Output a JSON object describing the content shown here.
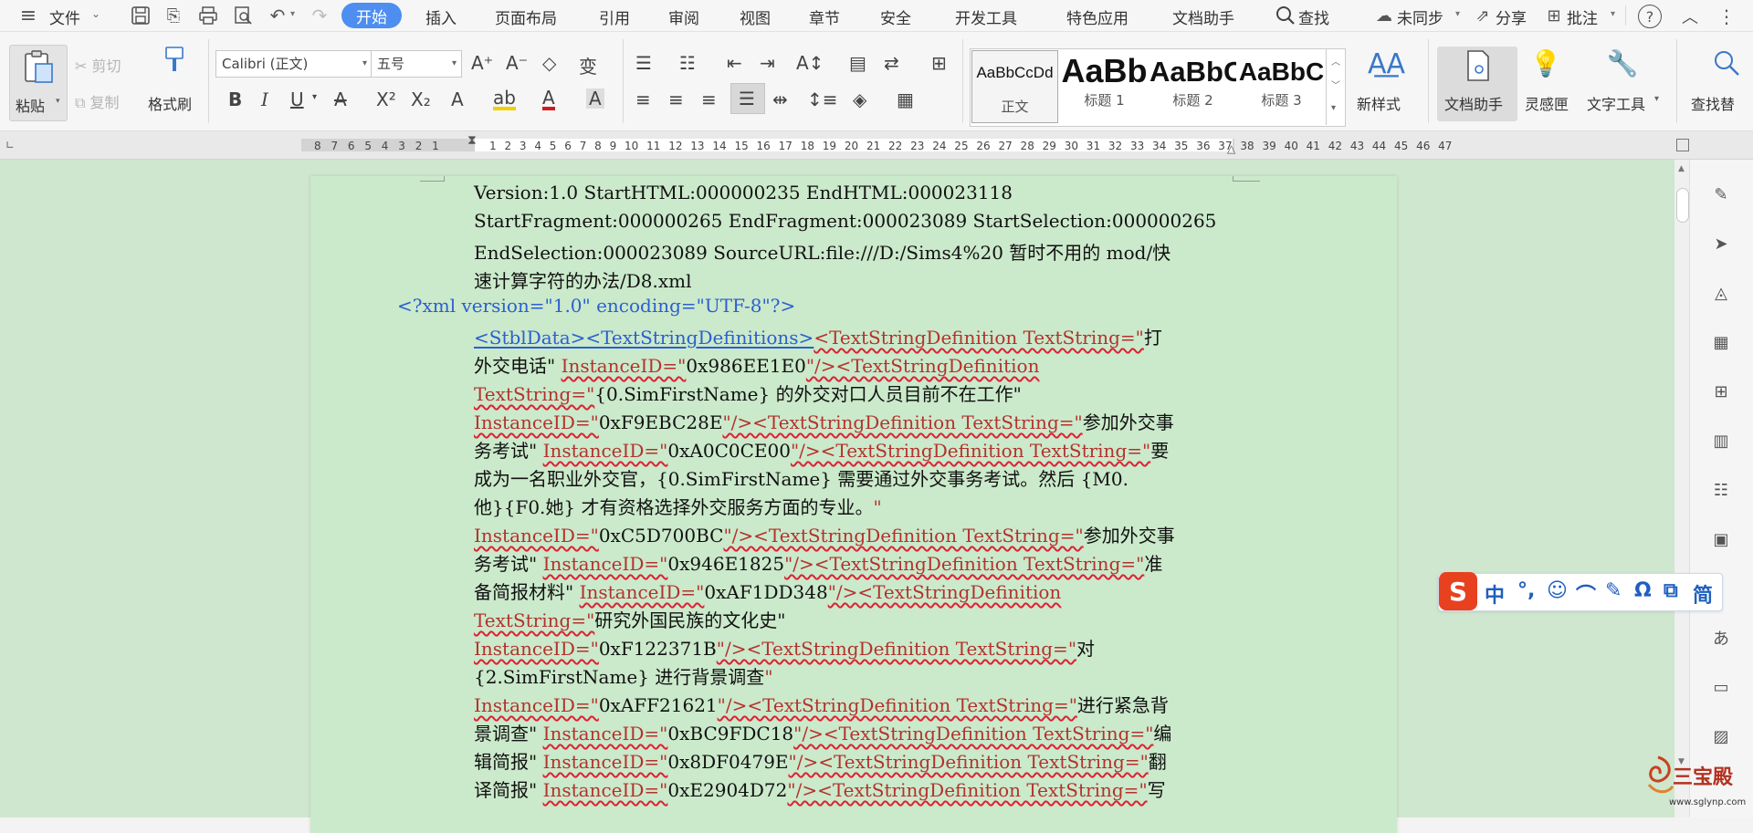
{
  "menubar": {
    "file_label": "文件",
    "tabs": [
      {
        "label": "开始",
        "active": true
      },
      {
        "label": "插入"
      },
      {
        "label": "页面布局"
      },
      {
        "label": "引用"
      },
      {
        "label": "审阅"
      },
      {
        "label": "视图"
      },
      {
        "label": "章节"
      },
      {
        "label": "安全"
      },
      {
        "label": "开发工具"
      },
      {
        "label": "特色应用"
      },
      {
        "label": "文档助手"
      }
    ],
    "search_label": "查找",
    "sync_label": "未同步",
    "share_label": "分享",
    "comment_label": "批注"
  },
  "ribbon": {
    "paste_label": "粘贴",
    "cut_label": "剪切",
    "copy_label": "复制",
    "format_painter_label": "格式刷",
    "font_name": "Calibri (正文)",
    "font_size": "五号",
    "styles": [
      {
        "sample": "AaBbCcDd",
        "caption": "正文"
      },
      {
        "sample": "AaBb",
        "caption": "标题 1"
      },
      {
        "sample": "AaBbC",
        "caption": "标题 2"
      },
      {
        "sample": "AaBbC",
        "caption": "标题 3"
      }
    ],
    "new_style_label": "新样式",
    "doc_assistant_label": "文档助手",
    "inspiration_label": "灵感匣",
    "text_tools_label": "文字工具",
    "find_replace_label": "查找替"
  },
  "ruler": {
    "left_numbers": "8 7 6 5 4 3 2 1",
    "right_numbers": "1 2 3 4 5 6 7 8 9 10 11 12 13 14 15 16 17 18 19 20 21 22 23 24 25 26 27 28 29 30 31 32 33 34 35 36 37 38 39 40 41 42 43 44 45 46 47"
  },
  "document": {
    "l1": "Version:1.0 StartHTML:000000235 EndHTML:000023118",
    "l2": "StartFragment:000000265 EndFragment:000023089 StartSelection:000000265",
    "l3": "EndSelection:000023089 SourceURL:file:///D:/Sims4%20 暂时不用的 mod/快",
    "l4": "速计算字符的办法/D8.xml",
    "l5": "<?xml version=\"1.0\" encoding=\"UTF-8\"?>",
    "l6a": "<StblData><TextStringDefinitions>",
    "l6b": "<TextStringDefinition TextString=\"",
    "l6c": "打",
    "l7a": "外交电话\" ",
    "l7b": "InstanceID=\"",
    "l7c": "0x986EE1E0",
    "l7d": "\"/><TextStringDefinition",
    "l8a": "TextString=\"",
    "l8b": "{0.SimFirstName} 的外交对口人员目前不在工作\"",
    "l9a": "InstanceID=\"",
    "l9b": "0xF9EBC28E",
    "l9c": "\"/><TextStringDefinition TextString=\"",
    "l9d": "参加外交事",
    "l10a": "务考试\" ",
    "l10b": "InstanceID=\"",
    "l10c": "0xA0C0CE00",
    "l10d": "\"/><TextStringDefinition TextString=\"",
    "l10e": "要",
    "l11": "成为一名职业外交官，{0.SimFirstName} 需要通过外交事务考试。然后 {M0.",
    "l12a": "他}{F0.她} 才有资格选择外交服务方面的专业。",
    "l12b": "\"",
    "l13a": "InstanceID=\"",
    "l13b": "0xC5D700BC",
    "l13c": "\"/><TextStringDefinition TextString=\"",
    "l13d": "参加外交事",
    "l14a": "务考试\" ",
    "l14b": "InstanceID=\"",
    "l14c": "0x946E1825",
    "l14d": "\"/><TextStringDefinition TextString=\"",
    "l14e": "准",
    "l15a": "备简报材料\" ",
    "l15b": "InstanceID=\"",
    "l15c": "0xAF1DD348",
    "l15d": "\"/><TextStringDefinition",
    "l16a": "TextString=\"",
    "l16b": "研究外国民族的文化史\"",
    "l17a": "InstanceID=\"",
    "l17b": "0xF122371B",
    "l17c": "\"/><TextStringDefinition TextString=\"",
    "l17d": "对",
    "l18a": "{2.SimFirstName} 进行背景调查",
    "l18b": "\"",
    "l19a": "InstanceID=\"",
    "l19b": "0xAFF21621",
    "l19c": "\"/><TextStringDefinition TextString=\"",
    "l19d": "进行紧急背",
    "l20a": "景调查\" ",
    "l20b": "InstanceID=\"",
    "l20c": "0xBC9FDC18",
    "l20d": "\"/><TextStringDefinition TextString=\"",
    "l20e": "编",
    "l21a": "辑简报\" ",
    "l21b": "InstanceID=\"",
    "l21c": "0x8DF0479E",
    "l21d": "\"/><TextStringDefinition TextString=\"",
    "l21e": "翻",
    "l22a": "译简报\" ",
    "l22b": "InstanceID=\"",
    "l22c": "0xE2904D72",
    "l22d": "\"/><TextStringDefinition TextString=\"",
    "l22e": "写"
  },
  "ime": {
    "items": [
      "中",
      "°,",
      "☺",
      "⌒",
      "✎",
      "Ω",
      "⧉",
      "简"
    ]
  },
  "watermark": {
    "line1": "三宝殿",
    "line2": "www.sglynp.com"
  }
}
